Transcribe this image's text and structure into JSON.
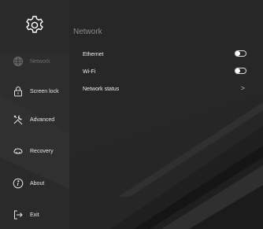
{
  "app": {
    "page_title": "Network"
  },
  "sidebar": {
    "settings_icon": "gear-icon",
    "items": [
      {
        "label": "Network",
        "icon": "globe-icon",
        "active": true
      },
      {
        "label": "Screen lock",
        "icon": "lock-icon",
        "active": false
      },
      {
        "label": "Advanced",
        "icon": "tools-icon",
        "active": false
      },
      {
        "label": "Recovery",
        "icon": "recovery-icon",
        "active": false
      },
      {
        "label": "About",
        "icon": "info-icon",
        "active": false
      },
      {
        "label": "Exit",
        "icon": "exit-icon",
        "active": false
      }
    ]
  },
  "network": {
    "ethernet": {
      "label": "Ethernet",
      "enabled": false
    },
    "wifi": {
      "label": "Wi-Fi",
      "enabled": false
    },
    "status": {
      "label": "Network status",
      "chevron": ">"
    }
  },
  "colors": {
    "background": "#252525",
    "sidebar_active_text": "#6d6d6d",
    "text": "#f0f0f0",
    "title": "#8a8a8a"
  }
}
